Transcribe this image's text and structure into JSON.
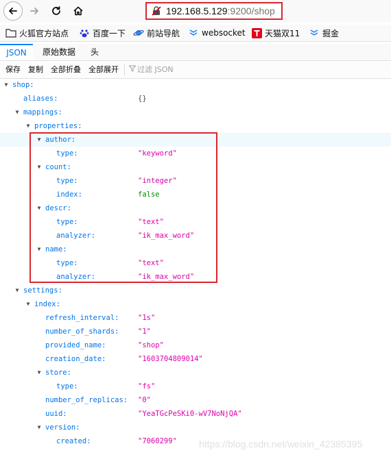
{
  "navbar": {
    "url_host": "192.168.5.129",
    "url_path": ":9200/shop"
  },
  "bookmarks": [
    {
      "label": "火狐官方站点",
      "icon": "folder-icon"
    },
    {
      "label": "百度一下",
      "icon": "baidu-paw-icon"
    },
    {
      "label": "前站导航",
      "icon": "planet-icon"
    },
    {
      "label": "websocket",
      "icon": "chevron-stack-icon"
    },
    {
      "label": "天猫双11",
      "icon": "tmall-t-icon"
    },
    {
      "label": "掘金",
      "icon": "chevron-stack-icon"
    }
  ],
  "tabs": {
    "json": "JSON",
    "raw": "原始数据",
    "headers": "头"
  },
  "toolbar": {
    "save": "保存",
    "copy": "复制",
    "collapse_all": "全部折叠",
    "expand_all": "全部展开",
    "filter_placeholder": "过滤 JSON"
  },
  "tree": [
    {
      "key": "shop:",
      "val": "",
      "level": 0,
      "twisty": true
    },
    {
      "key": "aliases:",
      "val": "{}",
      "type": "obj",
      "level": 1,
      "twisty": false
    },
    {
      "key": "mappings:",
      "val": "",
      "level": 1,
      "twisty": true
    },
    {
      "key": "properties:",
      "val": "",
      "level": 2,
      "twisty": true
    },
    {
      "key": "author:",
      "val": "",
      "level": 3,
      "twisty": true,
      "highlight": true
    },
    {
      "key": "type:",
      "val": "\"keyword\"",
      "type": "str",
      "level": 4
    },
    {
      "key": "count:",
      "val": "",
      "level": 3,
      "twisty": true
    },
    {
      "key": "type:",
      "val": "\"integer\"",
      "type": "str",
      "level": 4
    },
    {
      "key": "index:",
      "val": "false",
      "type": "bool",
      "level": 4
    },
    {
      "key": "descr:",
      "val": "",
      "level": 3,
      "twisty": true
    },
    {
      "key": "type:",
      "val": "\"text\"",
      "type": "str",
      "level": 4
    },
    {
      "key": "analyzer:",
      "val": "\"ik_max_word\"",
      "type": "str",
      "level": 4
    },
    {
      "key": "name:",
      "val": "",
      "level": 3,
      "twisty": true
    },
    {
      "key": "type:",
      "val": "\"text\"",
      "type": "str",
      "level": 4
    },
    {
      "key": "analyzer:",
      "val": "\"ik_max_word\"",
      "type": "str",
      "level": 4
    },
    {
      "key": "settings:",
      "val": "",
      "level": 1,
      "twisty": true
    },
    {
      "key": "index:",
      "val": "",
      "level": 2,
      "twisty": true
    },
    {
      "key": "refresh_interval:",
      "val": "\"1s\"",
      "type": "str",
      "level": 3
    },
    {
      "key": "number_of_shards:",
      "val": "\"1\"",
      "type": "str",
      "level": 3
    },
    {
      "key": "provided_name:",
      "val": "\"shop\"",
      "type": "str",
      "level": 3
    },
    {
      "key": "creation_date:",
      "val": "\"1603704809014\"",
      "type": "str",
      "level": 3
    },
    {
      "key": "store:",
      "val": "",
      "level": 3,
      "twisty": true
    },
    {
      "key": "type:",
      "val": "\"fs\"",
      "type": "str",
      "level": 4
    },
    {
      "key": "number_of_replicas:",
      "val": "\"0\"",
      "type": "str",
      "level": 3
    },
    {
      "key": "uuid:",
      "val": "\"YeaTGcPeSKi0-wV7NoNjQA\"",
      "type": "str",
      "level": 3
    },
    {
      "key": "version:",
      "val": "",
      "level": 3,
      "twisty": true
    },
    {
      "key": "created:",
      "val": "\"7060299\"",
      "type": "str",
      "level": 4
    }
  ],
  "watermark": "https://blog.csdn.net/weixin_42385395",
  "colors": {
    "key": "#0074e8",
    "string": "#dd00a9",
    "bool": "#058b00",
    "highlight_box": "#d9262d"
  }
}
